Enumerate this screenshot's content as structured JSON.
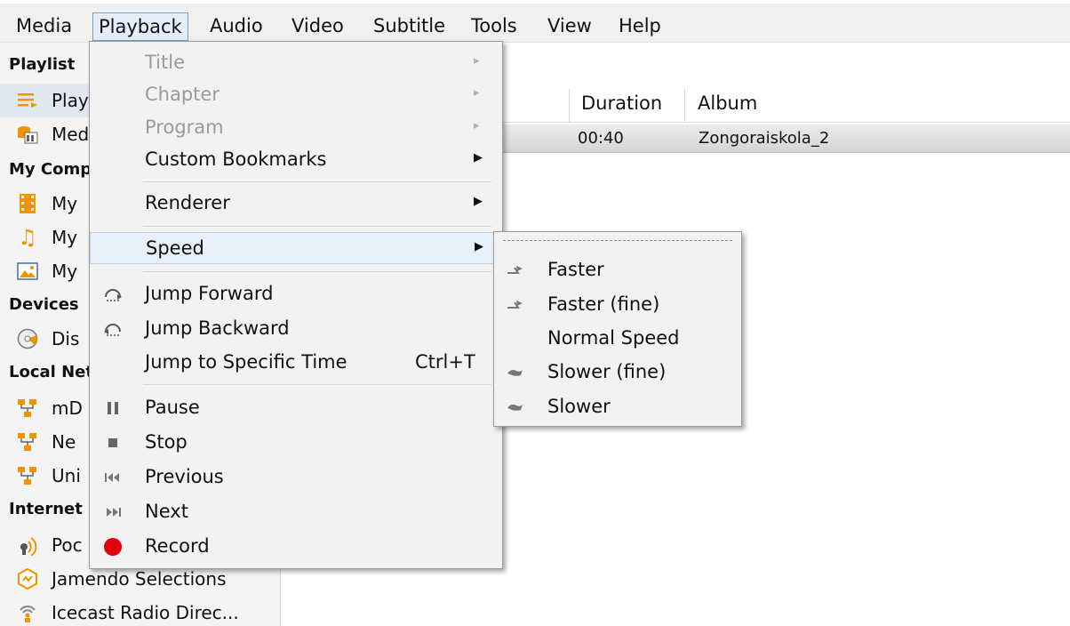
{
  "menubar": {
    "items": [
      {
        "label": "Media"
      },
      {
        "label": "Playback"
      },
      {
        "label": "Audio"
      },
      {
        "label": "Video"
      },
      {
        "label": "Subtitle"
      },
      {
        "label": "Tools"
      },
      {
        "label": "View"
      },
      {
        "label": "Help"
      }
    ]
  },
  "sidebar": {
    "playlist_header": "Playlist",
    "playlist_items": [
      "Play",
      "Med"
    ],
    "my_computer_header": "My Comp",
    "my_computer_items": [
      "My",
      "My",
      "My"
    ],
    "devices_header": "Devices",
    "devices_items": [
      "Dis"
    ],
    "local_network_header": "Local Net",
    "local_network_items": [
      "mD",
      "Ne",
      "Uni"
    ],
    "internet_header": "Internet",
    "internet_items": [
      "Poc",
      "Jamendo Selections",
      "Icecast Radio Direc..."
    ]
  },
  "playlist": {
    "columns": [
      "Duration",
      "Album"
    ],
    "rows": [
      {
        "duration": "00:40",
        "album": "Zongoraiskola_2"
      }
    ]
  },
  "playback_menu": {
    "title": "Title",
    "chapter": "Chapter",
    "program": "Program",
    "custom_bookmarks": "Custom Bookmarks",
    "renderer": "Renderer",
    "speed": "Speed",
    "jump_forward": "Jump Forward",
    "jump_backward": "Jump Backward",
    "jump_to_time": "Jump to Specific Time",
    "jump_to_time_shortcut": "Ctrl+T",
    "pause": "Pause",
    "stop": "Stop",
    "previous": "Previous",
    "next": "Next",
    "record": "Record"
  },
  "speed_submenu": {
    "items": [
      "Faster",
      "Faster (fine)",
      "Normal Speed",
      "Slower (fine)",
      "Slower"
    ]
  },
  "colors": {
    "record": "#e0000f",
    "accent_orange": "#f29400",
    "highlight": "#e8f0f9"
  }
}
